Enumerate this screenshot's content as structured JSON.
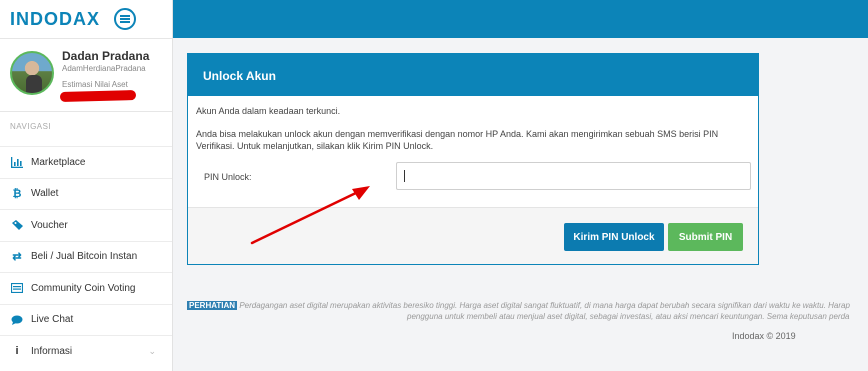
{
  "app": {
    "logo": "INDODAX"
  },
  "profile": {
    "name": "Dadan Pradana",
    "username": "AdamHerdianaPradana",
    "estimate_label": "Estimasi Nilai Aset"
  },
  "sidebar": {
    "section_title": "NAVIGASI",
    "items": [
      {
        "label": "Marketplace",
        "icon": "chart-icon"
      },
      {
        "label": "Wallet",
        "icon": "bitcoin-icon"
      },
      {
        "label": "Voucher",
        "icon": "ticket-icon"
      },
      {
        "label": "Beli / Jual Bitcoin Instan",
        "icon": "exchange-icon"
      },
      {
        "label": "Community Coin Voting",
        "icon": "vote-icon"
      },
      {
        "label": "Live Chat",
        "icon": "chat-icon"
      },
      {
        "label": "Informasi",
        "icon": "info-icon"
      }
    ]
  },
  "panel": {
    "title": "Unlock Akun",
    "text1": "Akun Anda dalam keadaan terkunci.",
    "text2": "Anda bisa melakukan unlock akun dengan memverifikasi dengan nomor HP Anda. Kami akan mengirimkan sebuah SMS berisi PIN Verifikasi. Untuk melanjutkan, silakan klik Kirim PIN Unlock.",
    "pin_label": "PIN Unlock:",
    "pin_value": "",
    "send_button": "Kirim PIN Unlock",
    "submit_button": "Submit PIN"
  },
  "footer": {
    "badge": "PERHATIAN",
    "line1": "Perdagangan aset digital merupakan aktivitas beresiko tinggi. Harga aset digital sangat fluktuatif, di mana harga dapat berubah secara signifikan dari waktu ke waktu. Harap",
    "line2": "pengguna untuk membeli atau menjual aset digital, sebagai investasi, atau aksi mencari keuntungan. Sema keputusan perda",
    "copyright": "Indodax © 2019"
  },
  "colors": {
    "brand": "#0c84b8",
    "success": "#5cb85c",
    "annotation": "#e00000"
  }
}
